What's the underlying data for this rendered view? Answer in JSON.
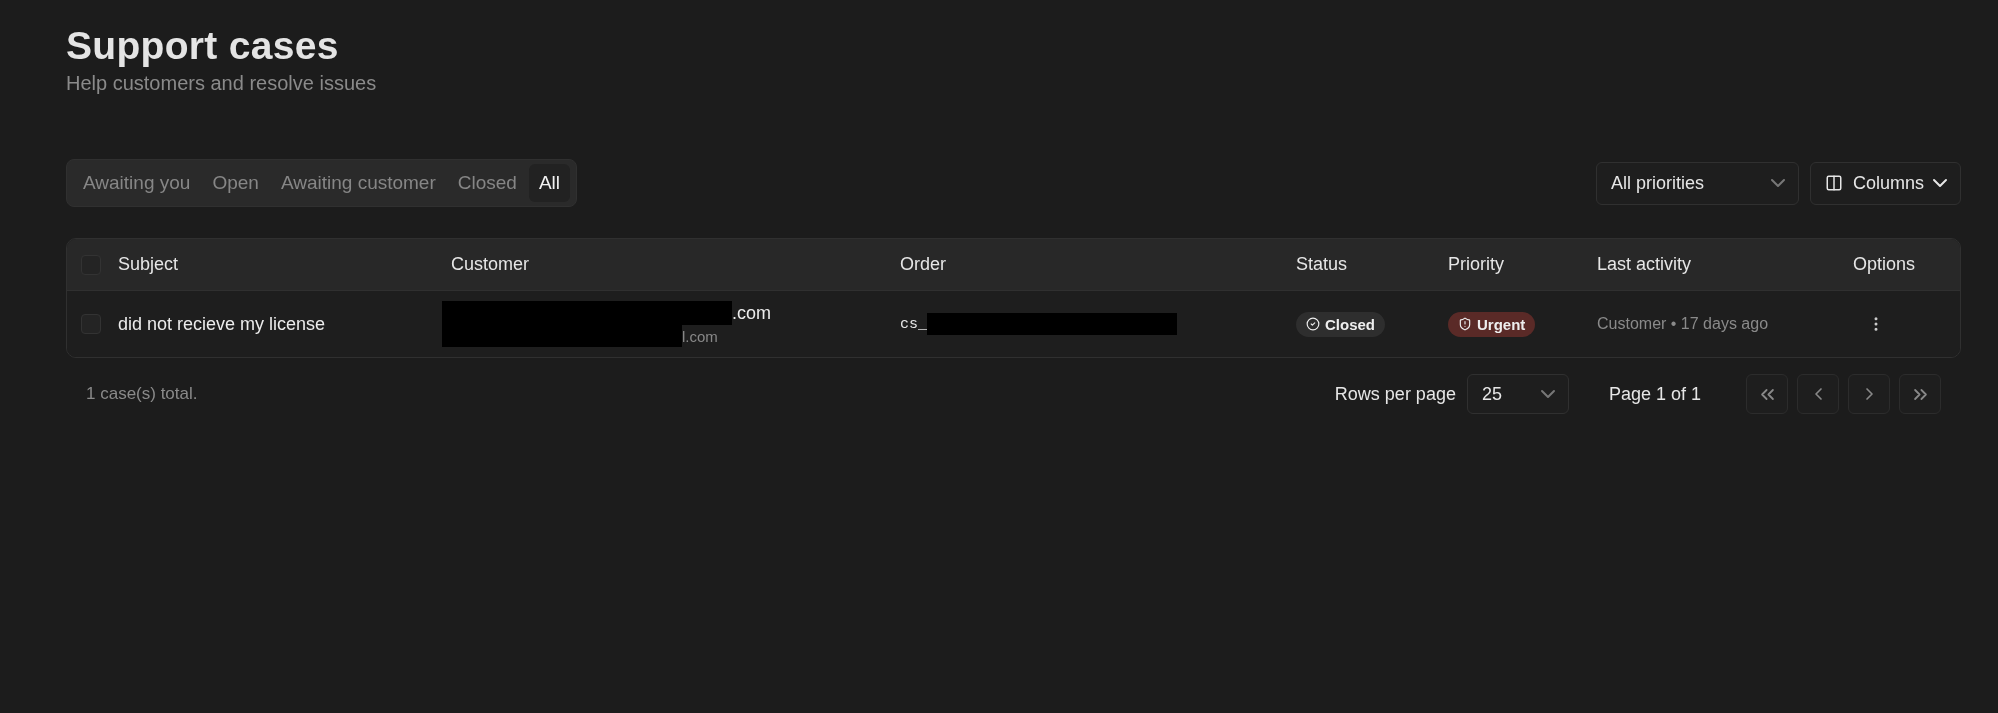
{
  "header": {
    "title": "Support cases",
    "subtitle": "Help customers and resolve issues"
  },
  "tabs": [
    {
      "label": "Awaiting you",
      "selected": false
    },
    {
      "label": "Open",
      "selected": false
    },
    {
      "label": "Awaiting customer",
      "selected": false
    },
    {
      "label": "Closed",
      "selected": false
    },
    {
      "label": "All",
      "selected": true
    }
  ],
  "priority_filter": {
    "value": "All priorities"
  },
  "columns_button": {
    "label": "Columns"
  },
  "table": {
    "select_all_checked": false,
    "columns": [
      "Subject",
      "Customer",
      "Order",
      "Status",
      "Priority",
      "Last activity",
      "Options"
    ],
    "rows": [
      {
        "checked": false,
        "subject": "did not recieve my license",
        "customer_name": ".com",
        "customer_email": "l.com",
        "order": "cs_",
        "status": "Closed",
        "priority": "Urgent",
        "last_activity": "Customer • 17 days ago"
      }
    ]
  },
  "footer": {
    "total": "1 case(s) total.",
    "rows_per_page_label": "Rows per page",
    "rows_per_page": "25",
    "page": "Page 1 of 1"
  }
}
